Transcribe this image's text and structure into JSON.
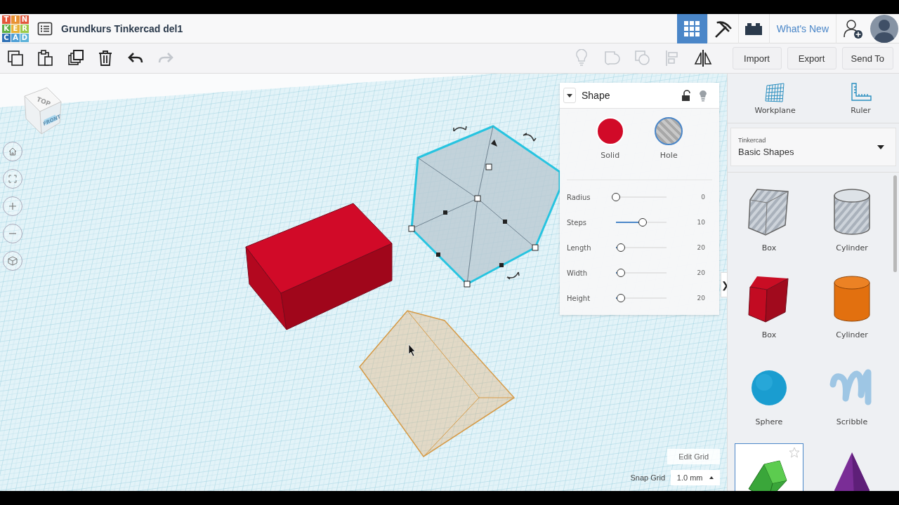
{
  "header": {
    "logo_letters": [
      {
        "char": "T",
        "color": "#e2563a"
      },
      {
        "char": "I",
        "color": "#e89132"
      },
      {
        "char": "N",
        "color": "#e2563a"
      },
      {
        "char": "K",
        "color": "#5fb047"
      },
      {
        "char": "E",
        "color": "#e8b236"
      },
      {
        "char": "R",
        "color": "#9ccb4a"
      },
      {
        "char": "C",
        "color": "#2d6fb5"
      },
      {
        "char": "A",
        "color": "#4d9fd6"
      },
      {
        "char": "D",
        "color": "#5bb2d9"
      }
    ],
    "title": "Grundkurs Tinkercad del1",
    "nav": [
      {
        "kind": "grid",
        "selected": true
      },
      {
        "kind": "pickaxe",
        "selected": false
      },
      {
        "kind": "bricks",
        "selected": false
      }
    ],
    "whats_new": "What's New"
  },
  "toolbar": {
    "left": [
      {
        "kind": "copy",
        "disabled": false
      },
      {
        "kind": "paste",
        "disabled": false
      },
      {
        "kind": "duplicate",
        "disabled": false
      },
      {
        "kind": "delete",
        "disabled": false
      },
      {
        "kind": "undo",
        "disabled": false
      },
      {
        "kind": "redo",
        "disabled": true
      }
    ],
    "right": [
      {
        "kind": "bulb",
        "disabled": true
      },
      {
        "kind": "group",
        "disabled": true
      },
      {
        "kind": "ungroup",
        "disabled": true
      },
      {
        "kind": "align",
        "disabled": true
      },
      {
        "kind": "mirror",
        "disabled": false
      }
    ],
    "buttons": [
      "Import",
      "Export",
      "Send To"
    ]
  },
  "viewcube": {
    "top": "TOP",
    "front": "FRONT"
  },
  "shape_panel": {
    "title": "Shape",
    "modes": [
      {
        "label": "Solid",
        "kind": "solid",
        "selected": false
      },
      {
        "label": "Hole",
        "kind": "hole",
        "selected": true
      }
    ],
    "params": [
      {
        "label": "Radius",
        "level": 0,
        "reading": "0"
      },
      {
        "label": "Steps",
        "level": 0.45,
        "reading": "10"
      },
      {
        "label": "Length",
        "level": 0.08,
        "reading": "20"
      },
      {
        "label": "Width",
        "level": 0.08,
        "reading": "20"
      },
      {
        "label": "Height",
        "level": 0.08,
        "reading": "20"
      }
    ],
    "collapse": "❯"
  },
  "grid_controls": {
    "edit": "Edit Grid",
    "snap_label": "Snap Grid",
    "snap_value": "1.0 mm"
  },
  "sidebar": {
    "tools": [
      {
        "label": "Workplane",
        "kind": "workplane"
      },
      {
        "label": "Ruler",
        "kind": "ruler"
      }
    ],
    "library": {
      "caption": "Tinkercad",
      "value": "Basic Shapes"
    },
    "shapes": [
      {
        "label": "Box",
        "kind": "box-hole",
        "selected": false
      },
      {
        "label": "Cylinder",
        "kind": "cylinder-hole",
        "selected": false
      },
      {
        "label": "Box",
        "kind": "box",
        "selected": false
      },
      {
        "label": "Cylinder",
        "kind": "cylinder",
        "selected": false
      },
      {
        "label": "Sphere",
        "kind": "sphere",
        "selected": false
      },
      {
        "label": "Scribble",
        "kind": "scribble",
        "selected": false
      },
      {
        "kind": "roof",
        "selected": true
      },
      {
        "kind": "cone",
        "selected": false
      }
    ]
  }
}
